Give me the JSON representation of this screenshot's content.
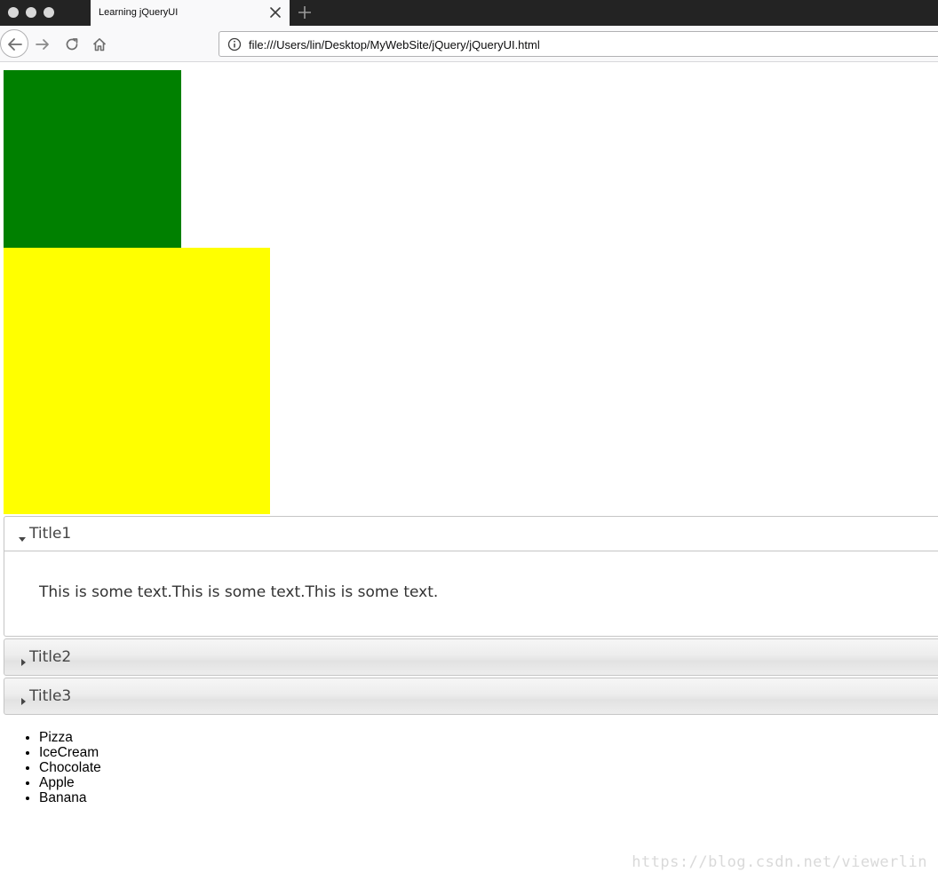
{
  "browser": {
    "tab_title": "Learning jQueryUI",
    "url": "file:///Users/lin/Desktop/MyWebSite/jQuery/jQueryUI.html"
  },
  "boxes": {
    "green_color": "#008000",
    "yellow_color": "#ffff00"
  },
  "accordion": {
    "sections": [
      {
        "title": "Title1",
        "content": "This is some text.This is some text.This is some text.",
        "expanded": true
      },
      {
        "title": "Title2",
        "expanded": false
      },
      {
        "title": "Title3",
        "expanded": false
      }
    ]
  },
  "list": {
    "items": [
      "Pizza",
      "IceCream",
      "Chocolate",
      "Apple",
      "Banana"
    ]
  },
  "watermark": "https://blog.csdn.net/viewerlin"
}
